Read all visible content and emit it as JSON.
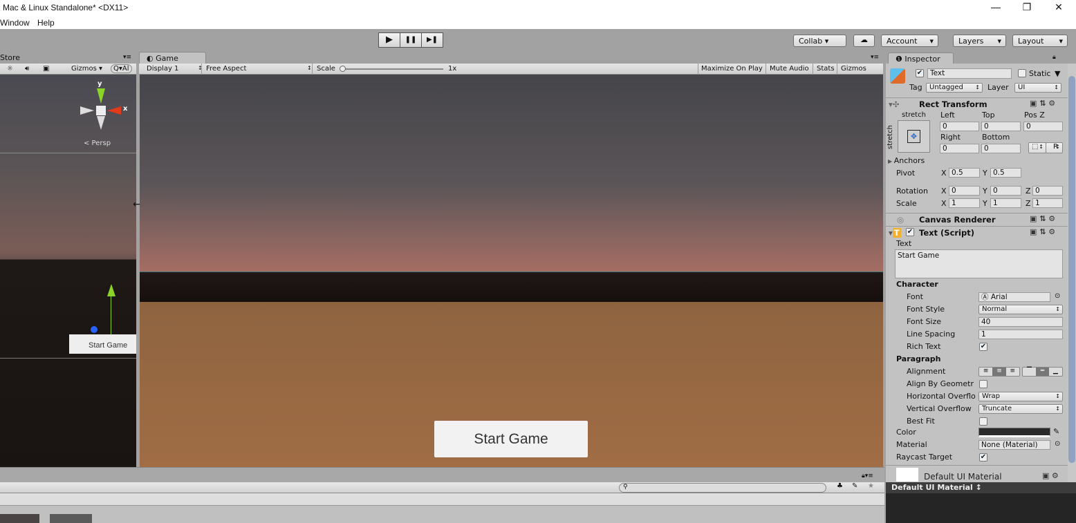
{
  "window": {
    "title": "Mac & Linux Standalone* <DX11>",
    "minimize": "—",
    "restore": "❐",
    "close": "✕"
  },
  "menu": [
    "Window",
    "Help"
  ],
  "toolbar": {
    "play": "▶",
    "pause": "❚❚",
    "step": "▶❚",
    "collab": "Collab ▾",
    "cloud": "☁",
    "account": "Account",
    "layers": "Layers",
    "layout": "Layout",
    "dropdown_arrow": "▾"
  },
  "scene": {
    "tab": "Store",
    "gizmos": "Gizmos ▾",
    "search": "Q▾Al",
    "persp": "< Persp",
    "axis_y": "y",
    "axis_x": "x",
    "object_label": "Start Game",
    "menu_icon": "▾≡"
  },
  "game": {
    "tab": "Game",
    "display": "Display 1",
    "aspect": "Free Aspect",
    "scale_label": "Scale",
    "scale_value": "1x",
    "scale_fraction": 0,
    "maximize": "Maximize On Play",
    "mute": "Mute Audio",
    "stats": "Stats",
    "gizmos": "Gizmos",
    "button_text": "Start Game",
    "colors": {
      "sky_top": "#45454a",
      "sky_horizon": "#a56d63",
      "band": "#1c1614",
      "ground": "#9a6b44",
      "button": "#f2f2f2"
    }
  },
  "inspector": {
    "tab": "Inspector",
    "object_name": "Text",
    "active": true,
    "static_label": "Static",
    "tag_label": "Tag",
    "tag": "Untagged",
    "layer_label": "Layer",
    "layer": "UI",
    "rect_transform": {
      "title": "Rect Transform",
      "stretch_h": "stretch",
      "stretch_v": "stretch",
      "left_label": "Left",
      "left": "0",
      "top_label": "Top",
      "top": "0",
      "posz_label": "Pos Z",
      "posz": "0",
      "right_label": "Right",
      "right": "0",
      "bottom_label": "Bottom",
      "bottom": "0",
      "r_btn": "R",
      "anchors": "Anchors",
      "pivot_label": "Pivot",
      "pivot_x": "0.5",
      "pivot_y": "0.5",
      "rotation_label": "Rotation",
      "rot_x": "0",
      "rot_y": "0",
      "rot_z": "0",
      "scale_label": "Scale",
      "scale_x": "1",
      "scale_y": "1",
      "scale_z": "1",
      "x": "X",
      "y": "Y",
      "z": "Z"
    },
    "canvas_renderer": {
      "title": "Canvas Renderer"
    },
    "text_script": {
      "title": "Text (Script)",
      "text_label": "Text",
      "text_value": "Start Game",
      "character": "Character",
      "font_label": "Font",
      "font": "Arial",
      "font_style_label": "Font Style",
      "font_style": "Normal",
      "font_size_label": "Font Size",
      "font_size": "40",
      "line_spacing_label": "Line Spacing",
      "line_spacing": "1",
      "rich_text_label": "Rich Text",
      "rich_text": true,
      "paragraph": "Paragraph",
      "alignment_label": "Alignment",
      "align_geom_label": "Align By Geometr",
      "align_geom": false,
      "h_overflow_label": "Horizontal Overflo",
      "h_overflow": "Wrap",
      "v_overflow_label": "Vertical Overflow",
      "v_overflow": "Truncate",
      "best_fit_label": "Best Fit",
      "best_fit": false,
      "color_label": "Color",
      "color": "#2b2b2b",
      "material_label": "Material",
      "material": "None (Material)",
      "raycast_label": "Raycast Target",
      "raycast": true
    },
    "material": {
      "name": "Default UI Material",
      "preview_header": "Default UI Material"
    }
  }
}
